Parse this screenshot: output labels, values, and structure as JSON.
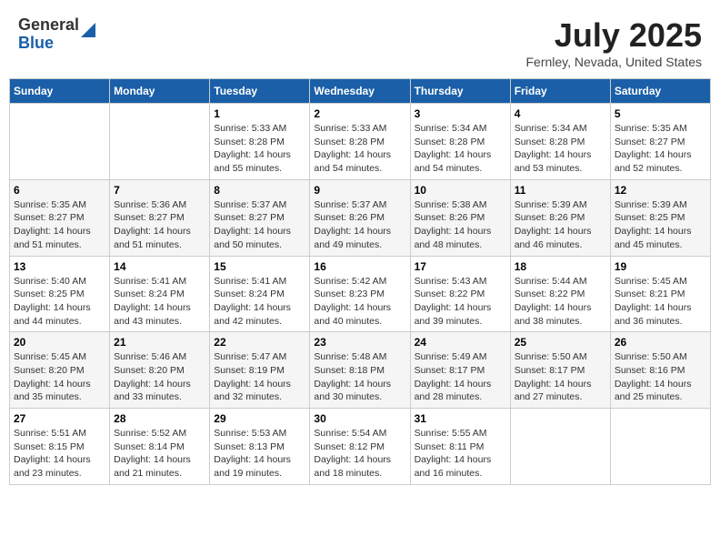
{
  "header": {
    "logo": {
      "general": "General",
      "blue": "Blue"
    },
    "title": "July 2025",
    "location": "Fernley, Nevada, United States"
  },
  "calendar": {
    "days_of_week": [
      "Sunday",
      "Monday",
      "Tuesday",
      "Wednesday",
      "Thursday",
      "Friday",
      "Saturday"
    ],
    "weeks": [
      [
        {
          "day": "",
          "info": ""
        },
        {
          "day": "",
          "info": ""
        },
        {
          "day": "1",
          "info": "Sunrise: 5:33 AM\nSunset: 8:28 PM\nDaylight: 14 hours and 55 minutes."
        },
        {
          "day": "2",
          "info": "Sunrise: 5:33 AM\nSunset: 8:28 PM\nDaylight: 14 hours and 54 minutes."
        },
        {
          "day": "3",
          "info": "Sunrise: 5:34 AM\nSunset: 8:28 PM\nDaylight: 14 hours and 54 minutes."
        },
        {
          "day": "4",
          "info": "Sunrise: 5:34 AM\nSunset: 8:28 PM\nDaylight: 14 hours and 53 minutes."
        },
        {
          "day": "5",
          "info": "Sunrise: 5:35 AM\nSunset: 8:27 PM\nDaylight: 14 hours and 52 minutes."
        }
      ],
      [
        {
          "day": "6",
          "info": "Sunrise: 5:35 AM\nSunset: 8:27 PM\nDaylight: 14 hours and 51 minutes."
        },
        {
          "day": "7",
          "info": "Sunrise: 5:36 AM\nSunset: 8:27 PM\nDaylight: 14 hours and 51 minutes."
        },
        {
          "day": "8",
          "info": "Sunrise: 5:37 AM\nSunset: 8:27 PM\nDaylight: 14 hours and 50 minutes."
        },
        {
          "day": "9",
          "info": "Sunrise: 5:37 AM\nSunset: 8:26 PM\nDaylight: 14 hours and 49 minutes."
        },
        {
          "day": "10",
          "info": "Sunrise: 5:38 AM\nSunset: 8:26 PM\nDaylight: 14 hours and 48 minutes."
        },
        {
          "day": "11",
          "info": "Sunrise: 5:39 AM\nSunset: 8:26 PM\nDaylight: 14 hours and 46 minutes."
        },
        {
          "day": "12",
          "info": "Sunrise: 5:39 AM\nSunset: 8:25 PM\nDaylight: 14 hours and 45 minutes."
        }
      ],
      [
        {
          "day": "13",
          "info": "Sunrise: 5:40 AM\nSunset: 8:25 PM\nDaylight: 14 hours and 44 minutes."
        },
        {
          "day": "14",
          "info": "Sunrise: 5:41 AM\nSunset: 8:24 PM\nDaylight: 14 hours and 43 minutes."
        },
        {
          "day": "15",
          "info": "Sunrise: 5:41 AM\nSunset: 8:24 PM\nDaylight: 14 hours and 42 minutes."
        },
        {
          "day": "16",
          "info": "Sunrise: 5:42 AM\nSunset: 8:23 PM\nDaylight: 14 hours and 40 minutes."
        },
        {
          "day": "17",
          "info": "Sunrise: 5:43 AM\nSunset: 8:22 PM\nDaylight: 14 hours and 39 minutes."
        },
        {
          "day": "18",
          "info": "Sunrise: 5:44 AM\nSunset: 8:22 PM\nDaylight: 14 hours and 38 minutes."
        },
        {
          "day": "19",
          "info": "Sunrise: 5:45 AM\nSunset: 8:21 PM\nDaylight: 14 hours and 36 minutes."
        }
      ],
      [
        {
          "day": "20",
          "info": "Sunrise: 5:45 AM\nSunset: 8:20 PM\nDaylight: 14 hours and 35 minutes."
        },
        {
          "day": "21",
          "info": "Sunrise: 5:46 AM\nSunset: 8:20 PM\nDaylight: 14 hours and 33 minutes."
        },
        {
          "day": "22",
          "info": "Sunrise: 5:47 AM\nSunset: 8:19 PM\nDaylight: 14 hours and 32 minutes."
        },
        {
          "day": "23",
          "info": "Sunrise: 5:48 AM\nSunset: 8:18 PM\nDaylight: 14 hours and 30 minutes."
        },
        {
          "day": "24",
          "info": "Sunrise: 5:49 AM\nSunset: 8:17 PM\nDaylight: 14 hours and 28 minutes."
        },
        {
          "day": "25",
          "info": "Sunrise: 5:50 AM\nSunset: 8:17 PM\nDaylight: 14 hours and 27 minutes."
        },
        {
          "day": "26",
          "info": "Sunrise: 5:50 AM\nSunset: 8:16 PM\nDaylight: 14 hours and 25 minutes."
        }
      ],
      [
        {
          "day": "27",
          "info": "Sunrise: 5:51 AM\nSunset: 8:15 PM\nDaylight: 14 hours and 23 minutes."
        },
        {
          "day": "28",
          "info": "Sunrise: 5:52 AM\nSunset: 8:14 PM\nDaylight: 14 hours and 21 minutes."
        },
        {
          "day": "29",
          "info": "Sunrise: 5:53 AM\nSunset: 8:13 PM\nDaylight: 14 hours and 19 minutes."
        },
        {
          "day": "30",
          "info": "Sunrise: 5:54 AM\nSunset: 8:12 PM\nDaylight: 14 hours and 18 minutes."
        },
        {
          "day": "31",
          "info": "Sunrise: 5:55 AM\nSunset: 8:11 PM\nDaylight: 14 hours and 16 minutes."
        },
        {
          "day": "",
          "info": ""
        },
        {
          "day": "",
          "info": ""
        }
      ]
    ]
  }
}
